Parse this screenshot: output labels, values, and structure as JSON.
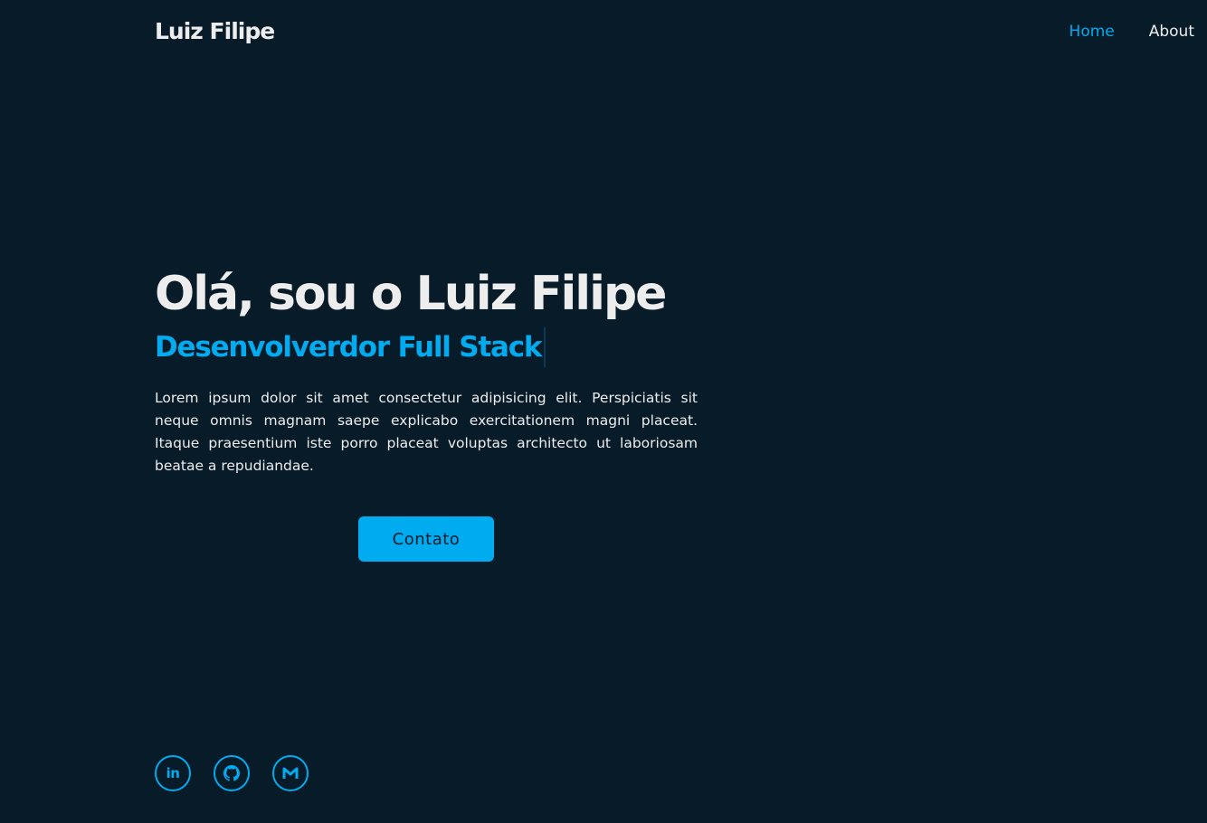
{
  "header": {
    "logo": "Luiz Filipe",
    "nav": [
      {
        "label": "Home",
        "active": true
      },
      {
        "label": "About",
        "active": false
      }
    ]
  },
  "hero": {
    "title": "Olá, sou o Luiz Filipe",
    "subtitle": "Desenvolverdor Full Stack",
    "description": "Lorem ipsum dolor sit amet consectetur adipisicing elit. Perspiciatis sit neque omnis magnam saepe explicabo exercitationem magni placeat. Itaque praesentium iste porro placeat voluptas architecto ut laboriosam beatae a repudiandae.",
    "cta_label": "Contato"
  },
  "socials": [
    {
      "icon": "linkedin-icon",
      "glyph": "in"
    },
    {
      "icon": "github-icon"
    },
    {
      "icon": "gmail-icon"
    }
  ],
  "colors": {
    "background": "#081b29",
    "accent": "#00abf0",
    "text": "#ededed"
  }
}
